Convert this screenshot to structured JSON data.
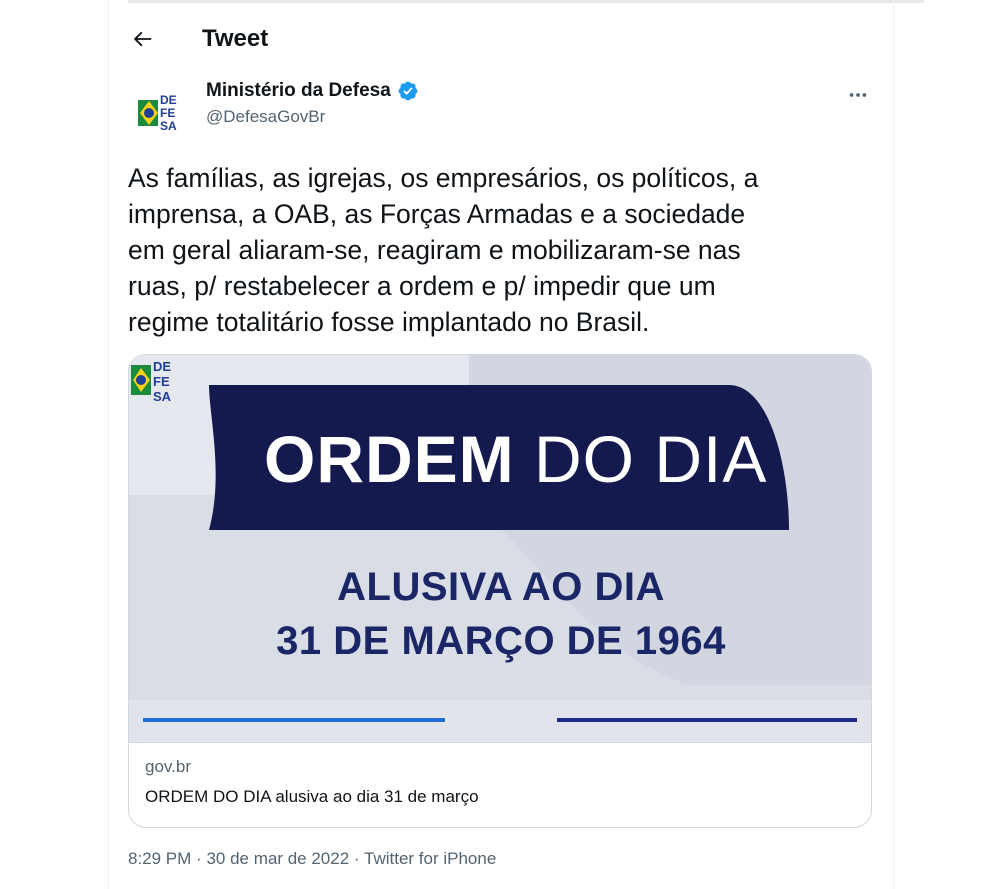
{
  "header": {
    "title": "Tweet",
    "back_icon": "arrow-left-icon"
  },
  "author": {
    "name": "Ministério da Defesa",
    "handle": "@DefesaGovBr",
    "avatar_text": [
      "DE",
      "FE",
      "SA"
    ],
    "verified_icon": "verified-badge-icon",
    "more_icon": "more-options-icon"
  },
  "tweet": {
    "text_lines": [
      "As famílias, as igrejas, os empresários, os políticos, a",
      "imprensa, a OAB, as Forças Armadas e a sociedade",
      "em geral aliaram-se, reagiram e mobilizaram-se nas",
      "ruas, p/ restabelecer a ordem e p/ impedir que um",
      "regime totalitário fosse implantado no Brasil."
    ]
  },
  "card": {
    "image": {
      "title_bold": "ORDEM",
      "title_light": "DO DIA",
      "subtitle_line1": "ALUSIVA AO DIA",
      "subtitle_line2": "31 DE MARÇO DE 1964",
      "logo_text": [
        "DE",
        "FE",
        "SA"
      ]
    },
    "domain": "gov.br",
    "title": "ORDEM DO DIA alusiva ao dia 31 de março"
  },
  "meta": {
    "time": "8:29 PM",
    "date": "30 de mar de 2022",
    "source": "Twitter for iPhone",
    "separator": "·"
  },
  "colors": {
    "verified_blue": "#1d9bf0",
    "banner_navy": "#141a4e",
    "subtitle_navy": "#1b2666",
    "secondary_text": "#536471",
    "brazil_green": "#1a8a3c",
    "brazil_yellow": "#f7d117",
    "brazil_blue": "#1f3f95"
  }
}
